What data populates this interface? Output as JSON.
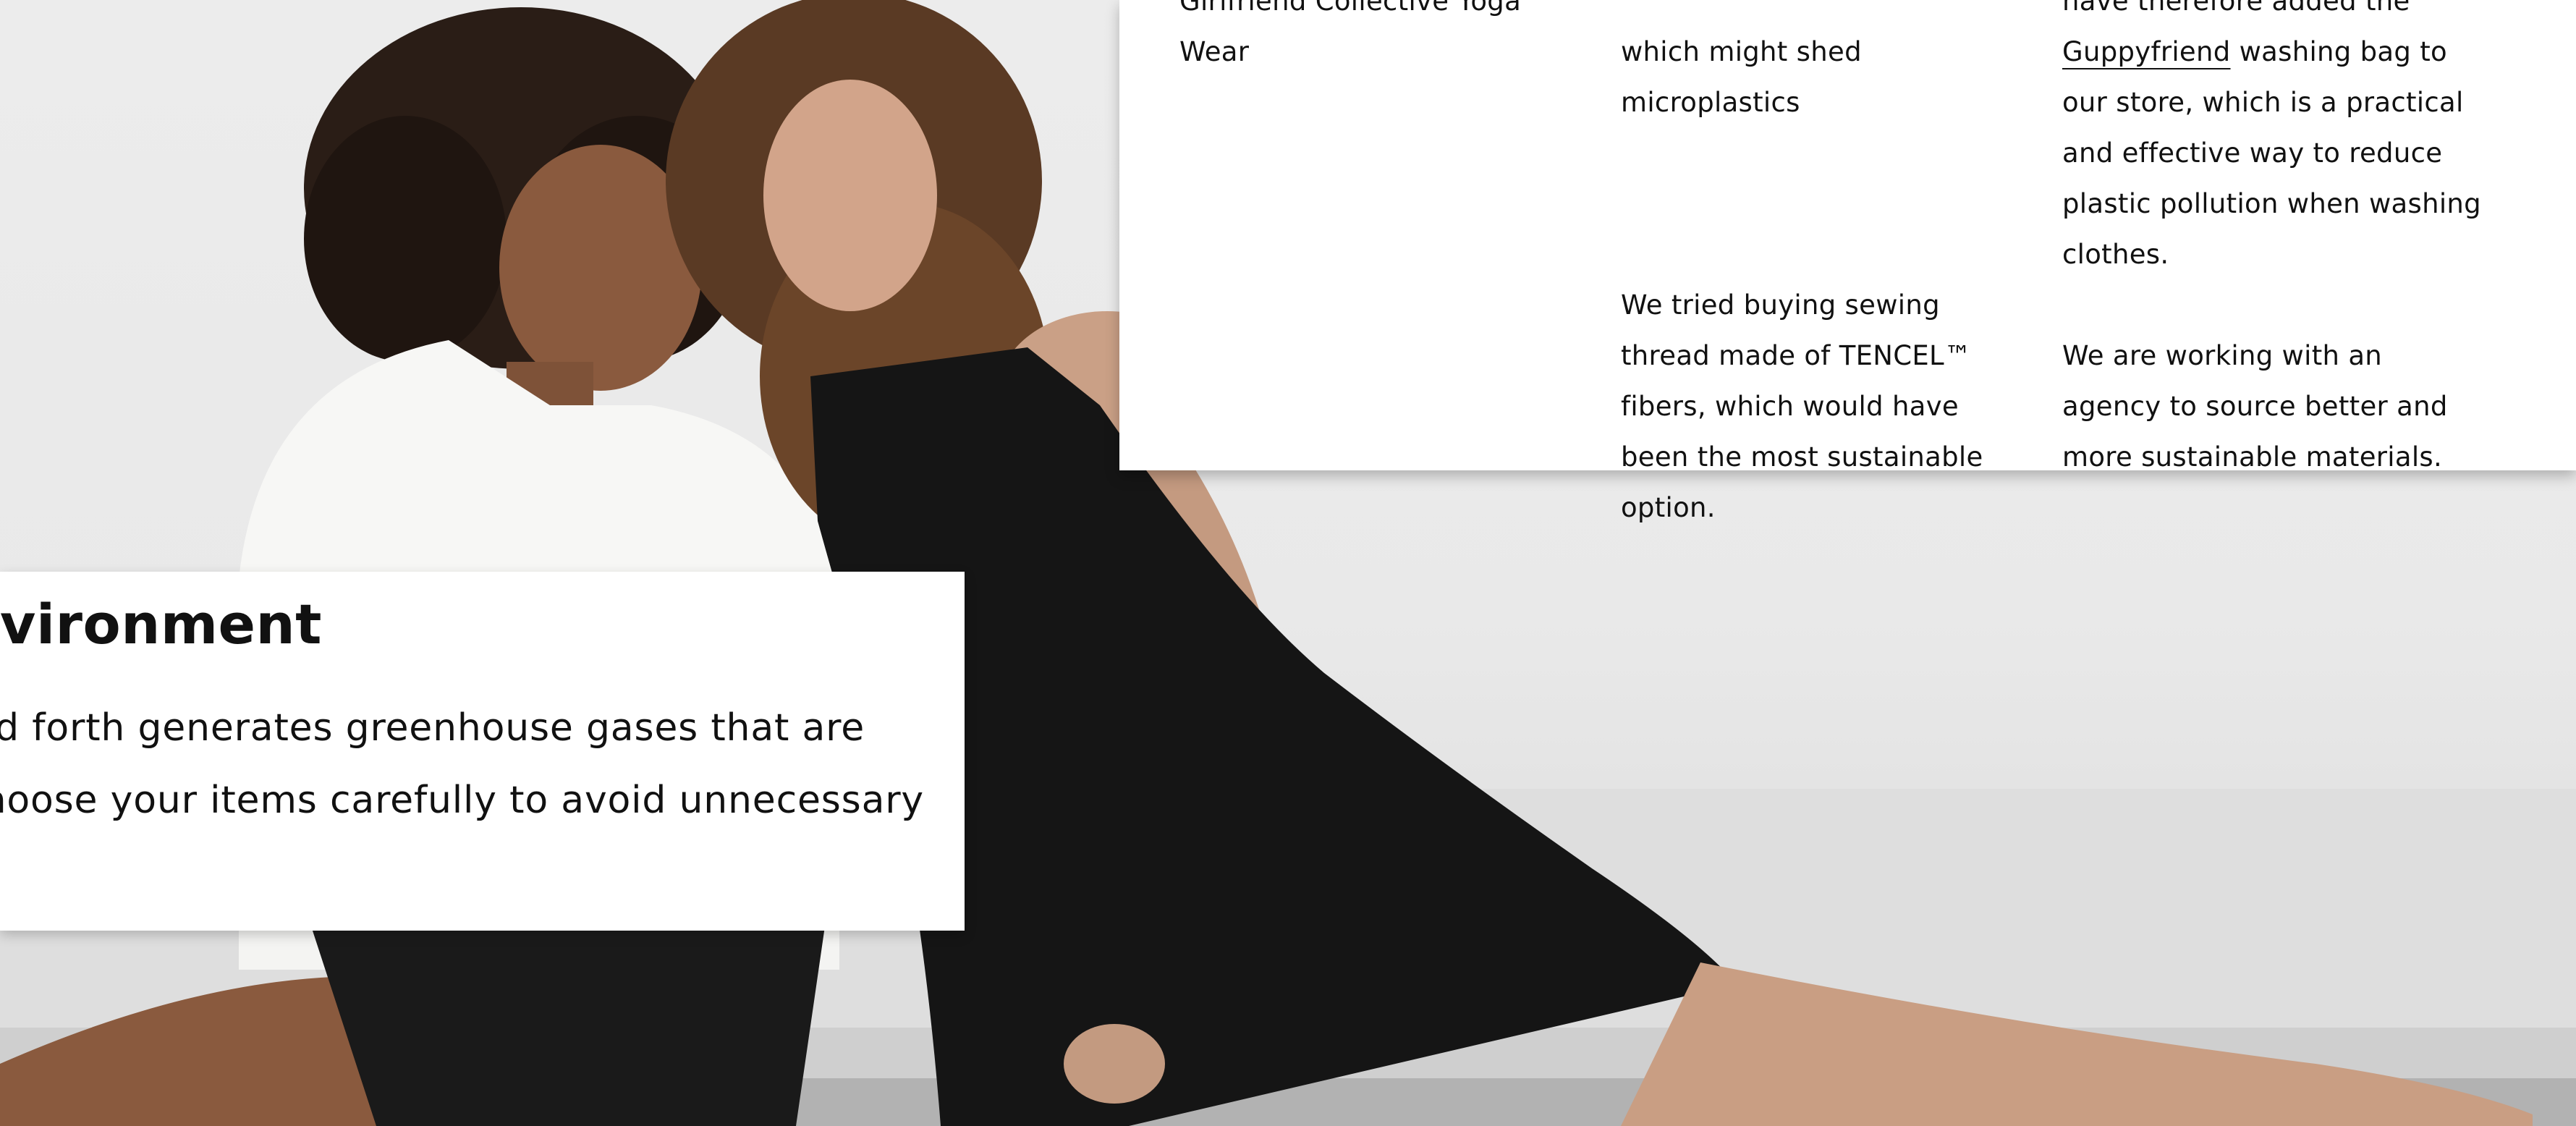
{
  "info_section": {
    "column_1": {
      "lines": [
        "Girlfriend Collective Yoga",
        "Wear"
      ]
    },
    "column_2": {
      "paragraph_a": "which might shed microplastics",
      "paragraph_b": "We tried buying sewing thread made of TENCEL™ fibers, which would have been the most sustainable option."
    },
    "column_3": {
      "line_top": "have therefore added the",
      "link_text": "Guppyfriend",
      "paragraph_a_rest": " washing bag to our store, which is a practical and effective way to reduce plastic pollution when washing clothes.",
      "paragraph_b": "We are working with an agency to source better and more sustainable materials."
    }
  },
  "environment_card": {
    "title": "environment",
    "line_1": "ack and forth generates greenhouse gases that are",
    "line_2": "u to choose your items carefully to avoid unnecessary"
  },
  "colors": {
    "card_background": "#ffffff",
    "text": "#111111",
    "backdrop": "#e9e9e9",
    "dress": "#151515",
    "shirt": "#f7f7f5"
  }
}
